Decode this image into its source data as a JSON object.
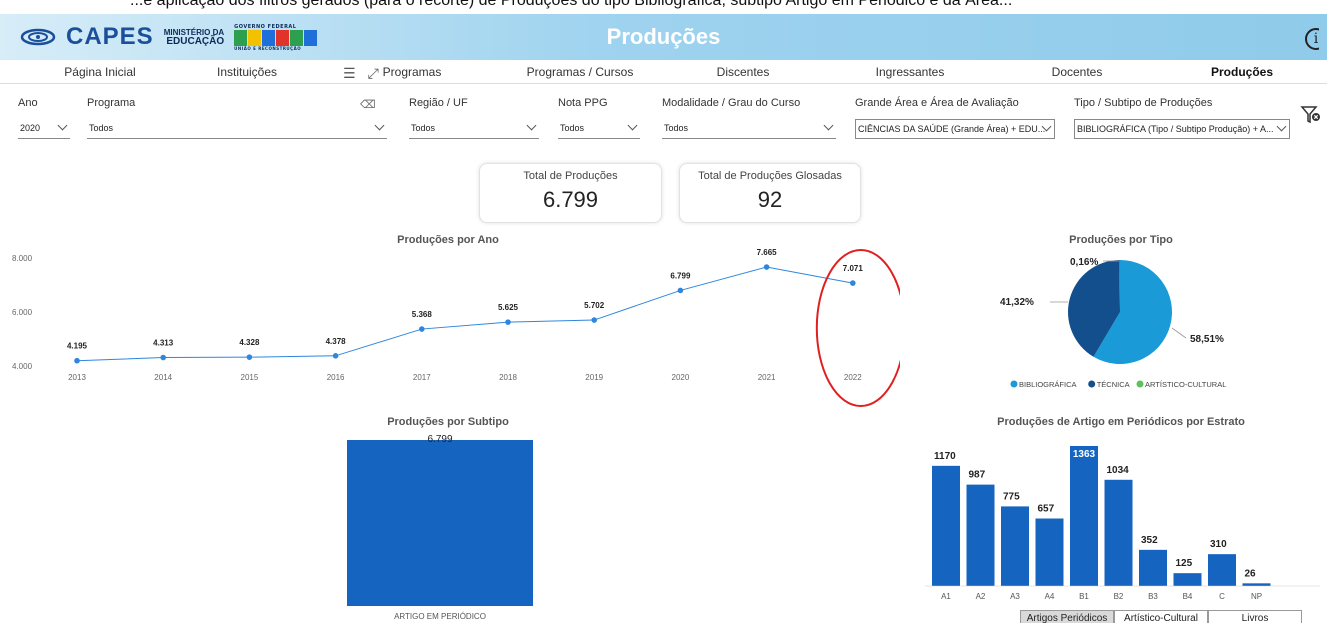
{
  "top_caption": "...e aplicação dos filtros gerados (para o recorte) de Produções do tipo Bibliográfica, subtipo Artigo em Periódico e da Área...",
  "header": {
    "title": "Produções",
    "logo_text": "CAPES",
    "ministry_line1": "MINISTÉRIO DA",
    "ministry_line2": "EDUCAÇÃO",
    "gov_text": "GOVERNO FEDERAL",
    "brasil_text": "BRASIL",
    "gov_slogan": "UNIÃO E RECONSTRUÇÃO",
    "info_icon": "i"
  },
  "nav": {
    "items": [
      {
        "label": "Página Inicial",
        "active": false
      },
      {
        "label": "Instituições",
        "active": false
      },
      {
        "label": "Programas",
        "active": false
      },
      {
        "label": "Programas / Cursos",
        "active": false
      },
      {
        "label": "Discentes",
        "active": false
      },
      {
        "label": "Ingressantes",
        "active": false
      },
      {
        "label": "Docentes",
        "active": false
      },
      {
        "label": "Produções",
        "active": true
      }
    ],
    "filter_lines_icon": "☰",
    "expand_icon": "⤢"
  },
  "filters": {
    "ano": {
      "label": "Ano",
      "value": "2020"
    },
    "programa": {
      "label": "Programa",
      "value": "Todos"
    },
    "regiao": {
      "label": "Região / UF",
      "value": "Todos"
    },
    "nota": {
      "label": "Nota PPG",
      "value": "Todos"
    },
    "modalidade": {
      "label": "Modalidade / Grau do Curso",
      "value": "Todos"
    },
    "grande_area": {
      "label": "Grande Área e Área de Avaliação",
      "value": "CIÊNCIAS DA SAÚDE (Grande Área) + EDU..."
    },
    "tipo": {
      "label": "Tipo / Subtipo de Produções",
      "value": "BIBLIOGRÁFICA (Tipo / Subtipo Produção) + A..."
    }
  },
  "cards": [
    {
      "title": "Total de Produções",
      "value": "6.799"
    },
    {
      "title": "Total de Produções Glosadas",
      "value": "92"
    }
  ],
  "chart_data": [
    {
      "type": "line",
      "title": "Produções por Ano",
      "x": [
        "2013",
        "2014",
        "2015",
        "2016",
        "2017",
        "2018",
        "2019",
        "2020",
        "2021",
        "2022"
      ],
      "values": [
        4195,
        4313,
        4328,
        4378,
        5368,
        5625,
        5702,
        6799,
        7665,
        7071
      ],
      "labels": [
        "4.195",
        "4.313",
        "4.328",
        "4.378",
        "5.368",
        "5.625",
        "5.702",
        "6.799",
        "7.665",
        "7.071"
      ],
      "yticks": [
        "8.000",
        "6.000",
        "4.000"
      ],
      "ytick_values": [
        8000,
        6000,
        4000
      ],
      "ylim": [
        4000,
        8000
      ],
      "color": "#2e86de",
      "highlight": "2022",
      "highlight_color": "#e02020"
    },
    {
      "type": "pie",
      "title": "Produções por Tipo",
      "slices": [
        {
          "name": "BIBLIOGRÁFICA",
          "value": 58.51,
          "label": "58,51%",
          "color": "#1a9ad6"
        },
        {
          "name": "TÉCNICA",
          "value": 41.32,
          "label": "41,32%",
          "color": "#124f8c"
        },
        {
          "name": "ARTÍSTICO-CULTURAL",
          "value": 0.16,
          "label": "0,16%",
          "color": "#5cc35c"
        }
      ]
    },
    {
      "type": "bar",
      "title": "Produções por Subtipo",
      "categories": [
        "ARTIGO EM PERIÓDICO"
      ],
      "values": [
        6799
      ],
      "labels": [
        "6.799"
      ],
      "color": "#1565c0"
    },
    {
      "type": "bar",
      "title": "Produções de Artigo em Periódicos por Estrato",
      "categories": [
        "A1",
        "A2",
        "A3",
        "A4",
        "B1",
        "B2",
        "B3",
        "B4",
        "C",
        "NP"
      ],
      "values": [
        1170,
        987,
        775,
        657,
        1363,
        1034,
        352,
        125,
        310,
        26
      ],
      "ylim": [
        0,
        1363
      ],
      "color": "#1565c0"
    }
  ],
  "bottom_tabs": [
    {
      "label": "Artigos Periódicos",
      "active": true
    },
    {
      "label": "Artístico-Cultural",
      "active": false
    },
    {
      "label": "Livros",
      "active": false
    }
  ]
}
